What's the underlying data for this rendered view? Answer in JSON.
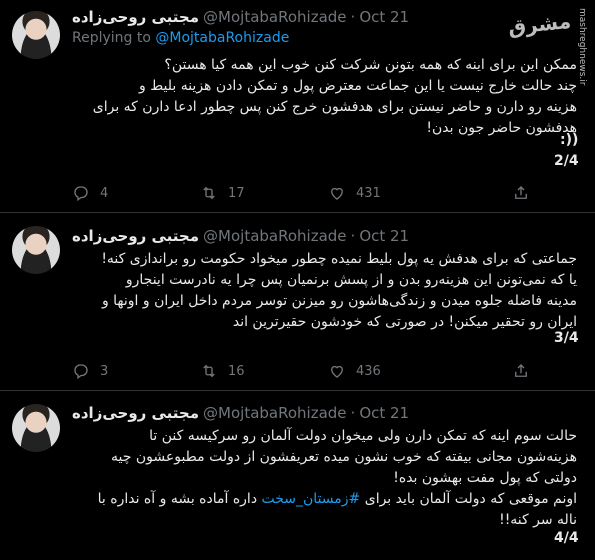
{
  "watermark": {
    "logo": "مشرق",
    "site": "mashreghnews.ir"
  },
  "tweets": [
    {
      "name": "مجتبی روحی‌زاده",
      "handle": "@MojtabaRohizade",
      "date": "Oct 21",
      "reply_prefix": "Replying to",
      "reply_handle": "@MojtabaRohizade",
      "lines": [
        "ممکن این برای اینه که همه بتونن شرکت کنن خوب این همه کیا هستن؟",
        "چند حالت خارج نیست یا این جماعت معترض پول و تمکن دادن هزینه بلیط و",
        "هزینه رو دارن و حاضر نیستن برای هدفشون خرج کنن پس چطور ادعا دارن که برای",
        "هدفشون حاضر جون بدن!",
        ":))"
      ],
      "counter": "2/4",
      "replies": "4",
      "retweets": "17",
      "likes": "431"
    },
    {
      "name": "مجتبی روحی‌زاده",
      "handle": "@MojtabaRohizade",
      "date": "Oct 21",
      "lines": [
        "جماعتی که برای هدفش یه پول بلیط نمیده چطور میخواد حکومت رو براندازی کنه!",
        "یا که نمی‌تونن این هزینه‌رو بدن و از پسش برنمیان پس چرا یه نادرست اینجارو",
        "مدینه فاضله جلوه میدن و زندگی‌هاشون رو میزنن توسر مردم داخل ایران و اونها و",
        "ایران رو تحقیر میکنن! در صورتی که خودشون حقیرترین اند"
      ],
      "counter": "3/4",
      "replies": "3",
      "retweets": "16",
      "likes": "436"
    },
    {
      "name": "مجتبی روحی‌زاده",
      "handle": "@MojtabaRohizade",
      "date": "Oct 21",
      "lines": [
        "حالت سوم اینه که تمکن دارن ولی میخوان دولت آلمان رو سرکیسه کنن تا",
        "هزینه‌شون مجانی بیفته که خوب نشون میده تعریفشون از دولت مطبوعشون چیه",
        "دولتی که پول مفت بهشون بده!"
      ],
      "line4_prefix": "اونم موقعی که دولت آلمان باید برای",
      "hashtag": "#زمستان_سخت",
      "line4_suffix": "داره آماده بشه و آه نداره با",
      "line5": "ناله سر کنه!!",
      "counter": "4/4",
      "colors": {
        "link": "#1d9bf0",
        "muted": "#71767b",
        "text": "#e7e9ea",
        "bg": "#000000"
      }
    }
  ]
}
